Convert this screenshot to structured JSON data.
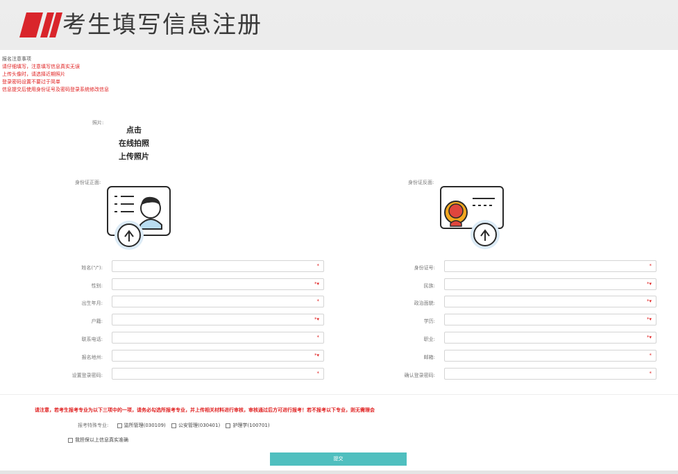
{
  "header": {
    "title": "考生填写信息注册",
    "logo_color": "#d9252b"
  },
  "notice": {
    "title": "报名注意事项",
    "lines": [
      "请仔细填写，注意填写信息真实无误",
      "上传头像时，请选择近期照片",
      "登录密码设置不要过于简单",
      "信息提交后使用身份证号及密码登录系统修改信息"
    ]
  },
  "photo": {
    "label": "照片:",
    "buttons": [
      "点击",
      "在线拍照",
      "上传照片"
    ]
  },
  "id_front": {
    "label": "身份证正面:",
    "icon": "id-card-front-upload-icon"
  },
  "id_back": {
    "label": "身份证反面:",
    "icon": "id-card-back-upload-icon"
  },
  "left_fields": [
    {
      "label": "姓名(\"/\"):",
      "req": "*"
    },
    {
      "label": "性别:",
      "req": "*▾"
    },
    {
      "label": "出生年月:",
      "req": "*"
    },
    {
      "label": "户籍:",
      "req": "*▾"
    },
    {
      "label": "联系电话:",
      "req": "*"
    },
    {
      "label": "报名地州:",
      "req": "*▾"
    },
    {
      "label": "设置登录密码:",
      "req": "*"
    }
  ],
  "right_fields": [
    {
      "label": "身份证号:",
      "req": "*"
    },
    {
      "label": "民族:",
      "req": "*▾"
    },
    {
      "label": "政治面貌:",
      "req": "*▾"
    },
    {
      "label": "学历:",
      "req": "*▾"
    },
    {
      "label": "职业:",
      "req": "*▾"
    },
    {
      "label": "邮箱:",
      "req": "*"
    },
    {
      "label": "确认登录密码:",
      "req": "*"
    }
  ],
  "specialty": {
    "warning": "请注意，若考生报考专业为以下三项中的一项，请务必勾选所报考专业，并上传相关材料进行审核，审核通过后方可进行报考！若不报考以下专业，则无需理会",
    "label": "报考特殊专业:",
    "options": [
      "监所管理(030109)",
      "公安管理(030401)",
      "护理学(100701)"
    ]
  },
  "confirm": {
    "label": "我担保以上信息真实准确"
  },
  "submit": {
    "label": "提交"
  },
  "colors": {
    "accent": "#4fbfbf",
    "warning": "#e02020",
    "brand": "#d9252b"
  }
}
